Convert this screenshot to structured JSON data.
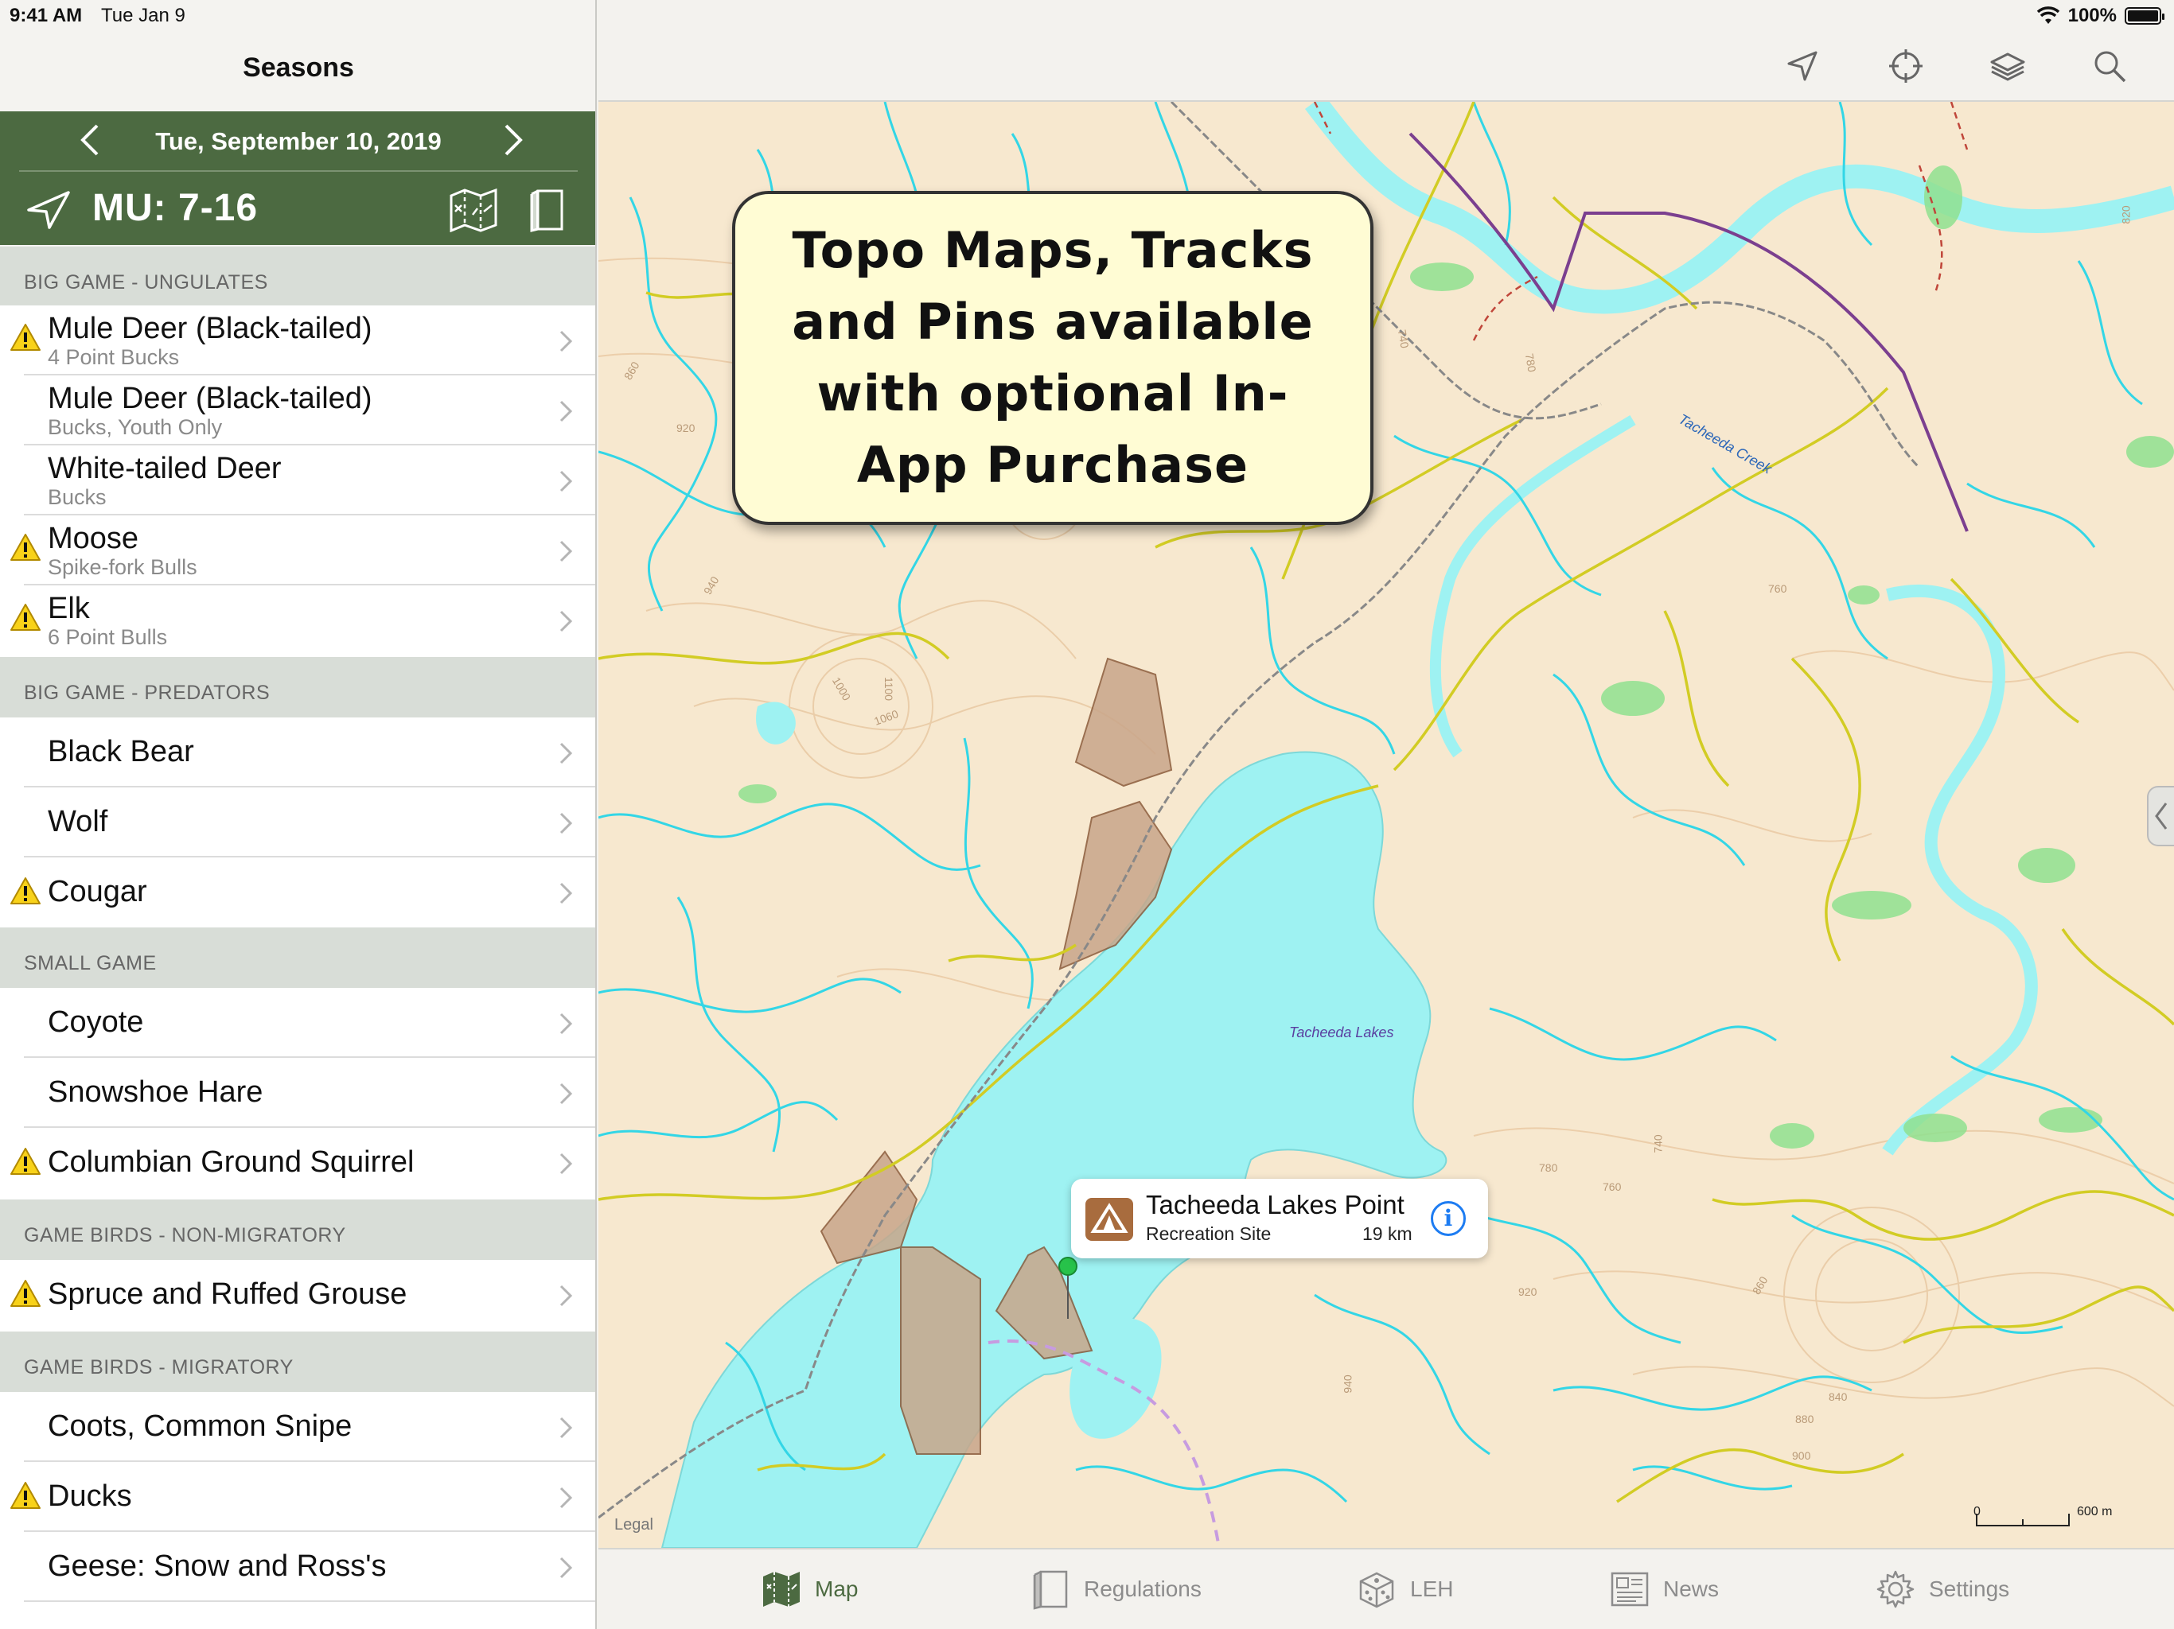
{
  "status": {
    "time": "9:41 AM",
    "date": "Tue Jan 9",
    "battery": "100%"
  },
  "sidebar": {
    "title": "Seasons",
    "date": "Tue, September 10, 2019",
    "mu": "MU: 7-16",
    "sections": [
      {
        "header": "BIG GAME - UNGULATES"
      },
      {
        "header": "BIG GAME - PREDATORS"
      },
      {
        "header": "SMALL GAME"
      },
      {
        "header": "GAME BIRDS - NON-MIGRATORY"
      },
      {
        "header": "GAME BIRDS - MIGRATORY"
      }
    ],
    "items": [
      {
        "title": "Mule Deer (Black-tailed)",
        "sub": "4 Point Bucks",
        "warning": true
      },
      {
        "title": "Mule Deer (Black-tailed)",
        "sub": "Bucks, Youth Only",
        "warning": false
      },
      {
        "title": "White-tailed Deer",
        "sub": "Bucks",
        "warning": false
      },
      {
        "title": "Moose",
        "sub": "Spike-fork Bulls",
        "warning": true
      },
      {
        "title": "Elk",
        "sub": "6 Point Bulls",
        "warning": true
      },
      {
        "title": "Black Bear",
        "sub": "",
        "warning": false
      },
      {
        "title": "Wolf",
        "sub": "",
        "warning": false
      },
      {
        "title": "Cougar",
        "sub": "",
        "warning": true
      },
      {
        "title": "Coyote",
        "sub": "",
        "warning": false
      },
      {
        "title": "Snowshoe Hare",
        "sub": "",
        "warning": false
      },
      {
        "title": "Columbian Ground Squirrel",
        "sub": "",
        "warning": true
      },
      {
        "title": "Spruce and Ruffed Grouse",
        "sub": "",
        "warning": true
      },
      {
        "title": "Coots, Common Snipe",
        "sub": "",
        "warning": false
      },
      {
        "title": "Ducks",
        "sub": "",
        "warning": true
      },
      {
        "title": "Geese: Snow and Ross's",
        "sub": "",
        "warning": false
      }
    ]
  },
  "map": {
    "callout": "Topo Maps, Tracks and Pins available with optional In-App Purchase",
    "poi": {
      "name": "Tacheeda Lakes Point",
      "type": "Recreation Site",
      "distance": "19 km",
      "info": "i"
    },
    "labels": {
      "lake": "Tacheeda Lakes",
      "creek": "Tacheeda Creek"
    },
    "legal": "Legal",
    "scale": {
      "start": "0",
      "end": "600 m"
    },
    "contours": [
      "860",
      "920",
      "940",
      "1000",
      "1100",
      "1060",
      "780",
      "740",
      "760",
      "780",
      "760",
      "840",
      "880",
      "900",
      "940",
      "920",
      "860",
      "740",
      "820"
    ],
    "colors": {
      "land": "#f7e8cf",
      "water": "#9ef2f2",
      "stream": "#33d6e6",
      "road": "#d2cc24",
      "park": "#c9a68a",
      "wetland": "#8fe08f"
    }
  },
  "tabs": [
    {
      "label": "Map",
      "icon": "map-icon",
      "active": true
    },
    {
      "label": "Regulations",
      "icon": "book-icon",
      "active": false
    },
    {
      "label": "LEH",
      "icon": "dice-icon",
      "active": false
    },
    {
      "label": "News",
      "icon": "newspaper-icon",
      "active": false
    },
    {
      "label": "Settings",
      "icon": "gear-icon",
      "active": false
    }
  ]
}
